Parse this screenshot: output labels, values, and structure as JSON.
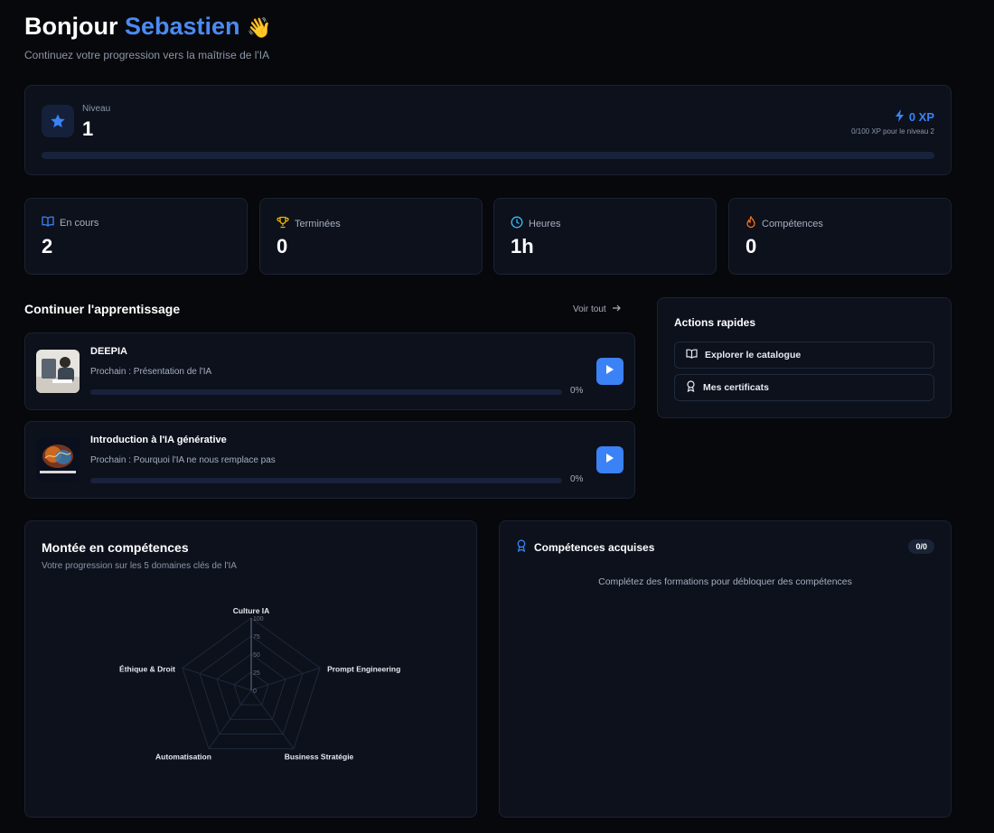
{
  "header": {
    "greeting": "Bonjour",
    "name": "Sebastien",
    "wave": "👋",
    "subtitle": "Continuez votre progression vers la maîtrise de l'IA"
  },
  "level": {
    "label": "Niveau",
    "value": "1",
    "xp": "0 XP",
    "xp_sub": "0/100 XP pour le niveau 2",
    "progress": 0
  },
  "stats": [
    {
      "label": "En cours",
      "value": "2",
      "icon": "book-icon"
    },
    {
      "label": "Terminées",
      "value": "0",
      "icon": "trophy-icon"
    },
    {
      "label": "Heures",
      "value": "1h",
      "icon": "clock-icon"
    },
    {
      "label": "Compétences",
      "value": "0",
      "icon": "flame-icon"
    }
  ],
  "continue": {
    "title": "Continuer l'apprentissage",
    "see_all": "Voir tout",
    "courses": [
      {
        "title": "DEEPIA",
        "next": "Prochain : Présentation de l'IA",
        "progress_label": "0%",
        "progress": 0
      },
      {
        "title": "Introduction à l'IA générative",
        "next": "Prochain : Pourquoi l'IA ne nous remplace pas",
        "progress_label": "0%",
        "progress": 0
      }
    ]
  },
  "actions": {
    "title": "Actions rapides",
    "items": [
      "Explorer le catalogue",
      "Mes certificats"
    ]
  },
  "skills": {
    "title": "Montée en compétences",
    "subtitle": "Votre progression sur les 5 domaines clés de l'IA"
  },
  "chart_data": {
    "type": "radar",
    "categories": [
      "Culture IA",
      "Prompt Engineering",
      "Business Stratégie",
      "Automatisation",
      "Éthique & Droit"
    ],
    "values": [
      0,
      0,
      0,
      0,
      0
    ],
    "ticks": [
      "0",
      "25",
      "50",
      "75",
      "100"
    ],
    "range": [
      0,
      100
    ]
  },
  "acquired": {
    "title": "Compétences acquises",
    "badge": "0/0",
    "empty": "Complétez des formations pour débloquer des compétences"
  },
  "colors": {
    "accent": "#3b82f6",
    "background": "#07080b",
    "card": "#0c111c"
  }
}
